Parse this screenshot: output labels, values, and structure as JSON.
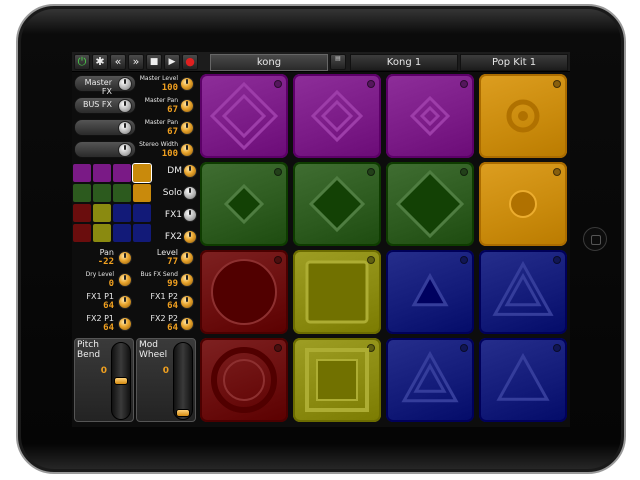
{
  "toolbar": {
    "buttons": [
      {
        "name": "power-icon",
        "glyph": "⏻"
      },
      {
        "name": "gear-icon",
        "glyph": "✱"
      },
      {
        "name": "rewind-icon",
        "glyph": "«"
      },
      {
        "name": "forward-icon",
        "glyph": "»"
      },
      {
        "name": "stop-icon",
        "glyph": "■"
      },
      {
        "name": "play-icon",
        "glyph": "▶"
      },
      {
        "name": "record-icon",
        "glyph": "●"
      }
    ],
    "instrument": "kong",
    "kit1": "Kong 1",
    "kit2": "Pop Kit 1"
  },
  "mixer": {
    "master_fx_label": "Master FX",
    "bus_fx_label": "BUS FX",
    "knobs": [
      {
        "label": "Master Level",
        "value": "100"
      },
      {
        "label": "Master Pan",
        "value": "67"
      },
      {
        "label": "Master Pan",
        "value": "67"
      },
      {
        "label": "Stereo Width",
        "value": "100"
      }
    ]
  },
  "toggles": [
    {
      "label": "DM"
    },
    {
      "label": "Solo"
    },
    {
      "label": "FX1"
    },
    {
      "label": "FX2"
    }
  ],
  "params": [
    {
      "label": "Pan",
      "value": "-22"
    },
    {
      "label": "Level",
      "value": "77"
    },
    {
      "label": "Dry Level",
      "value": "0"
    },
    {
      "label": "Bus FX Send",
      "value": "99"
    },
    {
      "label": "FX1 P1",
      "value": "64"
    },
    {
      "label": "FX1 P2",
      "value": "64"
    },
    {
      "label": "FX2 P1",
      "value": "64"
    },
    {
      "label": "FX2 P2",
      "value": "64"
    }
  ],
  "pitch_bend": {
    "label1": "Pitch",
    "label2": "Bend",
    "value": "0"
  },
  "mod_wheel": {
    "label1": "Mod",
    "label2": "Wheel",
    "value": "0"
  },
  "colors": {
    "purple": "#7a1a86",
    "orange": "#c98a0c",
    "green": "#2c5a1e",
    "red": "#6a0d0d",
    "yellow": "#8a8a10",
    "blue": "#121a78",
    "accent_text": "#f0a020"
  },
  "mini_grid": [
    [
      "purple",
      "purple",
      "purple",
      "orange"
    ],
    [
      "green",
      "green",
      "green",
      "orange"
    ],
    [
      "red",
      "yellow",
      "blue",
      "blue"
    ],
    [
      "red",
      "yellow",
      "blue",
      "blue"
    ]
  ],
  "pads": [
    [
      {
        "color": "purple",
        "shape": "diamond-large"
      },
      {
        "color": "purple",
        "shape": "diamond-medium"
      },
      {
        "color": "purple",
        "shape": "diamond-small"
      },
      {
        "color": "orange",
        "shape": "ring"
      }
    ],
    [
      {
        "color": "green",
        "shape": "diamond-filled-small"
      },
      {
        "color": "green",
        "shape": "diamond-filled-medium"
      },
      {
        "color": "green",
        "shape": "diamond-filled-large"
      },
      {
        "color": "orange",
        "shape": "circle-filled"
      }
    ],
    [
      {
        "color": "red",
        "shape": "circle-large"
      },
      {
        "color": "yellow",
        "shape": "square-large"
      },
      {
        "color": "blue",
        "shape": "triangle-filled-small"
      },
      {
        "color": "blue",
        "shape": "triangle-outline-large"
      }
    ],
    [
      {
        "color": "red",
        "shape": "circle-ring"
      },
      {
        "color": "yellow",
        "shape": "square-outline"
      },
      {
        "color": "blue",
        "shape": "triangle-outline-medium"
      },
      {
        "color": "blue",
        "shape": "triangle-outline-small"
      }
    ]
  ]
}
